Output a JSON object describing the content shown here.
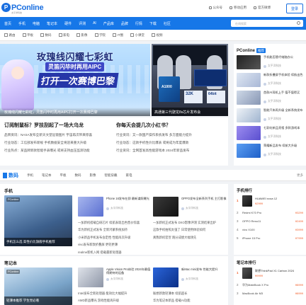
{
  "header": {
    "logo_letter": "P",
    "logo_text": "PConline",
    "logo_sub": "太平洋科技",
    "links": [
      "公众号",
      "移动应用",
      "官方微博"
    ],
    "login": "登录"
  },
  "nav": {
    "items": [
      "首页",
      "手机",
      "电脑",
      "笔记本",
      "硬件",
      "评测",
      "AI",
      "产品库",
      "品牌",
      "行情",
      "下载",
      "社区"
    ],
    "search_placeholder": "在线搜索"
  },
  "subnav": {
    "items": [
      "路由",
      "平板",
      "数码",
      "家电",
      "影像",
      "学院",
      "IT圈",
      "小课堂",
      "视频"
    ]
  },
  "hero": {
    "title_line1": "玫瑰线闪耀七彩虹",
    "title_line2": "灵笛闪毕时再用AIPC",
    "title_line3": "打开一次赛博巴黎",
    "caption_left": "玫瑰线闪耀七彩虹，灵笛闪毕时再用AIPC打开一次赛博巴黎",
    "chip_text": "A1000",
    "panel_a": "32K",
    "panel_b": "64bit",
    "caption_right": "高通第三代骁龙8s芯片发布会"
  },
  "headlines": {
    "left_title": "订阅制鼠标？罗技刮起了一场大乌龙",
    "left_items": [
      "品牌资讯：NASA发布全新天文望远镜图片 宇宙再次带来惊喜",
      "行业动态：工信部发布新规 手机数据安全将迎来重大升级",
      "行业热点：某品牌新款智能手表曝光 或将支持血压监测功能"
    ],
    "right_title": "你每天会提几次小红书？",
    "right_items": [
      "行业资讯：又一款国产操作系统发布 多方面能力提升",
      "行业动态：这款手机性价比爆表 或将成为年度爆款",
      "行业资讯：全网首发高性能游戏本 2024年新品发布"
    ]
  },
  "sidebar": {
    "title": "PConline",
    "badge": "推荐",
    "items": [
      {
        "text": "手机能否替代电脑办公",
        "meta": "太平洋科技"
      },
      {
        "text": "新款折叠屏手机体验 续航出色",
        "meta": "太平洋科技"
      },
      {
        "text": "首款AI耳机上手 值不值得买",
        "meta": "太平洋科技"
      },
      {
        "text": "智能汽车再升级 全新系统发布",
        "meta": "太平洋科技"
      },
      {
        "text": "七彩虹新品亮相 多款游戏本",
        "meta": "太平洋科技"
      },
      {
        "text": "荣耀新品发布 续航大升级",
        "meta": "太平洋科技"
      }
    ]
  },
  "section_tabs": {
    "title": "数码",
    "items": [
      "手机",
      "笔记本",
      "平板",
      "数码",
      "影像",
      "智能穿戴",
      "家电"
    ],
    "more": "更多"
  },
  "phones": {
    "label": "手机",
    "feature_tag": "PConline",
    "feature_caption": "手机怎么选 高性价比旗舰手机推荐",
    "cards": [
      {
        "title": "Phone 16发布在即 最新谍照曝光",
        "meta": "太平洋科技"
      },
      {
        "title": "OPPO发布全新系列手机 主打影像",
        "meta": "太平洋科技"
      }
    ],
    "list": [
      "一加新机搭载自研芯片 续航表现出色售价惊喜",
      "华为新机正式发布 全新鸿蒙系统加持",
      "小米新品手机发布会定档 性能再次升级",
      "vivo发布新款折叠屏 更轻更薄",
      "realme新机入网 搭载最新处理器"
    ],
    "list_right": [
      "一加新机正式发布 DXO影像评测 实测结果出炉",
      "这款手机拍照太强了 日常使用体验如何",
      "真我新机官宣 跑分成绩大幅领先"
    ]
  },
  "notebooks": {
    "label": "笔记本",
    "feature_tag": "PConline",
    "feature_caption": "轻薄本推荐 学生党必看",
    "cards": [
      {
        "title": "Apple Vision Pro体验 2024年最值得期待的设备",
        "meta": "太平洋科技"
      },
      {
        "title": "新Mac mini发布 性能大提升",
        "meta": "太平洋科技"
      }
    ],
    "list": [
      "Intel发布全新处理器 能效比大幅提升",
      "AMD新品曝光 游戏性能再升级"
    ],
    "list_right": [
      "联想新款轻薄本 续航超长",
      "华为笔记本新品 搭载AI功能"
    ]
  },
  "rank_phone": {
    "title": "手机排行",
    "items": [
      {
        "num": "1",
        "name": "HUAWEI nova 12",
        "price": "¥2999"
      },
      {
        "num": "2",
        "name": "Redmi K70 Pro",
        "price": "¥3299"
      },
      {
        "num": "3",
        "name": "OPPO Reno11",
        "price": "¥2499"
      },
      {
        "num": "4",
        "name": "vivo X100",
        "price": "¥3999"
      },
      {
        "num": "5",
        "name": "iPhone 15 Pro",
        "price": "¥7999"
      }
    ]
  },
  "rank_note": {
    "title": "笔记本排行",
    "items": [
      {
        "num": "1",
        "name": "联想ThinkPad X1 Carbon 2024",
        "price": "¥9999"
      },
      {
        "num": "2",
        "name": "华为MateBook X Pro",
        "price": "¥8999"
      },
      {
        "num": "3",
        "name": "MacBook Air M3",
        "price": "¥8999"
      }
    ]
  },
  "colors": {
    "brand": "#1677e8",
    "price": "#f25f2b"
  }
}
